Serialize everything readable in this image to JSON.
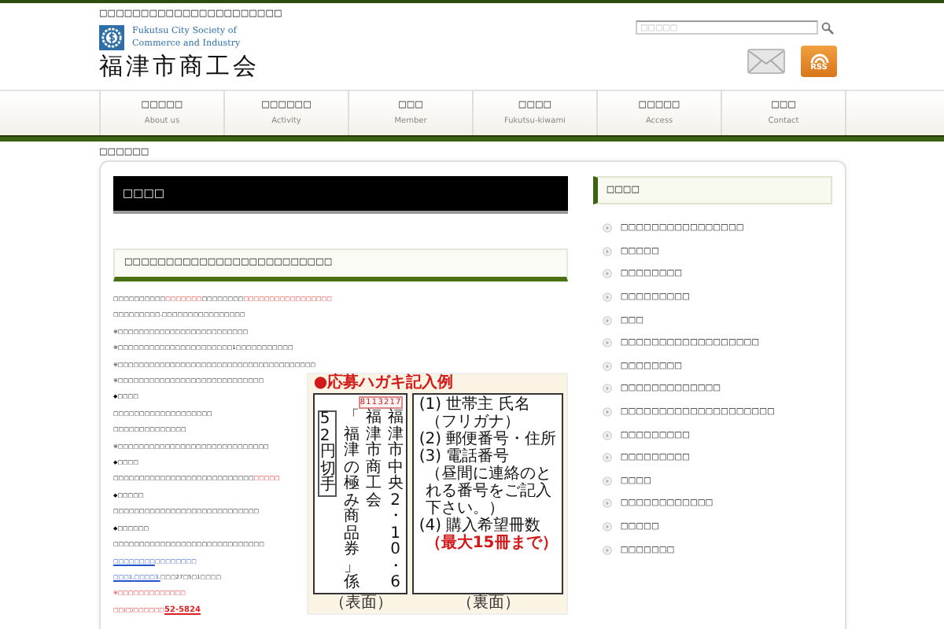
{
  "header": {
    "tagline": "□□□□□□□□□□□□□□□□□□□□□□",
    "logo_en": [
      "Fukutsu City Society of",
      "Commerce and Industry"
    ],
    "logo_jp": "福津市商工会",
    "search": {
      "placeholder": "□□□□□"
    },
    "rss_label": "RSS"
  },
  "nav": [
    {
      "label": "□□□□□",
      "sub": "About us"
    },
    {
      "label": "□□□□□□",
      "sub": "Activity"
    },
    {
      "label": "□□□",
      "sub": "Member"
    },
    {
      "label": "□□□□",
      "sub": "Fukutsu-kiwami"
    },
    {
      "label": "□□□□□",
      "sub": "Access"
    },
    {
      "label": "□□□",
      "sub": "Contact"
    }
  ],
  "breadcrumb": "□□□□□□",
  "page_title": "□□□□",
  "subtitle": "□□□□□□□□□□□□□□□□□□□□□□□□□",
  "body": [
    {
      "segments": [
        {
          "kind": "plain",
          "text": "□□□□□□□□□□"
        },
        {
          "kind": "red",
          "text": "□□□□□□□"
        },
        {
          "kind": "plain",
          "text": "□□□□□□□□"
        },
        {
          "kind": "red",
          "text": "□□□□□□□□□□□□□□□□□"
        }
      ]
    },
    {
      "segments": [
        {
          "kind": "plain",
          "text": "□□□□□□□□□.□□□□□□□□□□□□□□□□"
        }
      ]
    },
    {
      "segments": [
        {
          "kind": "plain",
          "text": "※□□□□□□□□□□□□□□□□□□□□□□□□□"
        }
      ]
    },
    {
      "segments": [
        {
          "kind": "plain",
          "text": "※□□□□□□□□□□□□□□□□□□□□□□1□□□□□□□□□□□"
        }
      ]
    },
    {
      "segments": [
        {
          "kind": "plain",
          "text": "※□□□□□□□□□□□□□□□□□□□□□□□□□□□□□□□□□□□□□□"
        }
      ]
    },
    {
      "segments": [
        {
          "kind": "plain",
          "text": "※□□□□□□□□□□□□□□□□□□□□□□□□□□□□"
        }
      ]
    },
    {
      "segments": [
        {
          "kind": "plain",
          "text": "◆□□□□"
        }
      ]
    },
    {
      "segments": [
        {
          "kind": "plain",
          "text": "□□□□□□□□□□□□□□□□□□□"
        }
      ]
    },
    {
      "segments": [
        {
          "kind": "plain",
          "text": "□□□□□□□□□□□□□□"
        }
      ]
    },
    {
      "segments": [
        {
          "kind": "plain",
          "text": "※□□□□□□□□□□□□□□□□□□□□□□□□□□□□□"
        }
      ]
    },
    {
      "segments": [
        {
          "kind": "plain",
          "text": "◆□□□□"
        }
      ]
    },
    {
      "segments": [
        {
          "kind": "plain",
          "text": "□□□□□□□□□□□□□□□□□□□□□□□□□□□"
        },
        {
          "kind": "red",
          "text": "□□□□□"
        }
      ]
    },
    {
      "segments": [
        {
          "kind": "plain",
          "text": "◆□□□□□"
        }
      ]
    },
    {
      "segments": [
        {
          "kind": "plain",
          "text": "□□□□□□□□□□□□□□□□□□□□□□□□□□□□"
        }
      ]
    },
    {
      "segments": [
        {
          "kind": "plain",
          "text": "◆□□□□□□"
        }
      ]
    },
    {
      "segments": [
        {
          "kind": "plain",
          "text": "□□□□□□□□□□□□□□□□□□□□□□□□□□□□□"
        }
      ]
    },
    {
      "segments": [
        {
          "kind": "link",
          "text": "□□□□□□□□"
        },
        {
          "kind": "blue",
          "text": "□□□□□□□□"
        }
      ]
    },
    {
      "segments": [
        {
          "kind": "link",
          "text": "□□□1."
        },
        {
          "kind": "link",
          "text": "□□□□3."
        },
        {
          "kind": "gray",
          "text": "□□□27□5□1□□□□"
        }
      ]
    },
    {
      "segments": [
        {
          "kind": "red",
          "text": "※□□□□□□□□□□□□□"
        }
      ]
    },
    {
      "segments": [
        {
          "kind": "red",
          "text": "□□(□)□□□□□□"
        },
        {
          "kind": "phone",
          "text": "52-5824"
        }
      ]
    }
  ],
  "postcard": {
    "title": "●応募ハガキ記入例",
    "stamp": "52円切手",
    "postal_code": "8113217",
    "address": "福津市中央2・10・6",
    "recipient": "福津市商工会",
    "department": "「福津の極み商品券」係",
    "back_lines": [
      {
        "kind": "item",
        "text": "(1) 世帯主 氏名"
      },
      {
        "kind": "note",
        "text": "（フリガナ）"
      },
      {
        "kind": "item",
        "text": "(2) 郵便番号・住所"
      },
      {
        "kind": "item",
        "text": "(3) 電話番号"
      },
      {
        "kind": "note",
        "text": "（昼間に連絡のとれる番号をご記入下さい。）"
      },
      {
        "kind": "item",
        "text": "(4) 購入希望冊数"
      },
      {
        "kind": "emph",
        "text": "（最大15冊まで）"
      }
    ],
    "front_caption": "（表面）",
    "back_caption": "（裏面）"
  },
  "sidebar": {
    "heading": "□□□□",
    "items": [
      "□□□□□□□□□□□□□□□□",
      "□□□□□",
      "□□□□□□□□",
      "□□□□□□□□□",
      "□□□",
      "□□□□□□□□□□□□□□□□□□",
      "□□□□□□□□",
      "□□□□□□□□□□□□□",
      "□□□□□□□□□□□□□□□□□□□□",
      "□□□□□□□□□",
      "□□□□□□□□□",
      "□□□□",
      "□□□□□□□□□□□□",
      "□□□□□",
      "□□□□□□□"
    ]
  }
}
